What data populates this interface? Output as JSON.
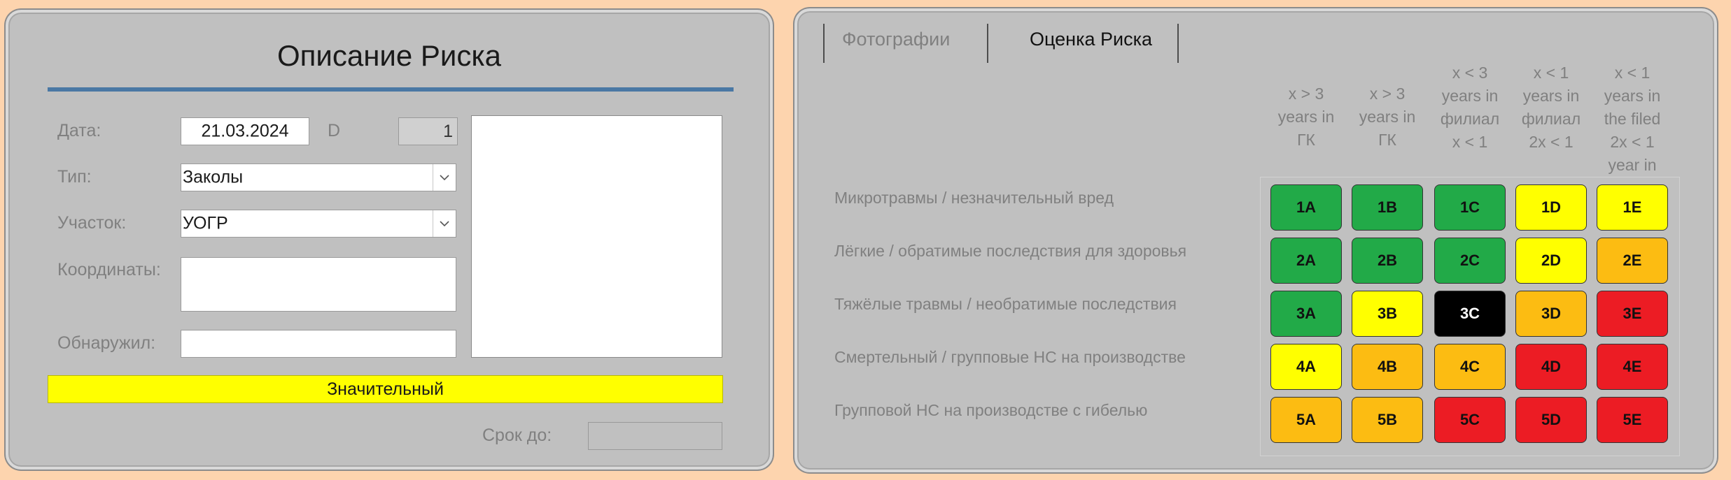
{
  "risk_description": {
    "title": "Описание Риска",
    "date_label": "Дата:",
    "date_value": "21.03.2024",
    "id_label": "D",
    "id_value": "1",
    "type_label": "Тип:",
    "type_value": "Заколы",
    "area_label": "Участок:",
    "area_value": "УОГР",
    "coords_label": "Координаты:",
    "coords_value": "",
    "found_by_label": "Обнаружил:",
    "found_by_value": "",
    "significance": "Значительный",
    "due_label": "Срок до:",
    "due_value": ""
  },
  "tabs": [
    {
      "label": "Фотографии",
      "active": false
    },
    {
      "label": "Оценка Риска",
      "active": true
    }
  ],
  "risk_matrix": {
    "columns": [
      [
        "x > 3",
        "years in",
        "ГК"
      ],
      [
        "x > 3",
        "years in",
        "ГК"
      ],
      [
        "x < 3",
        "years in",
        "филиал",
        "x < 1"
      ],
      [
        "x < 1",
        "years in",
        "филиал",
        "2x < 1"
      ],
      [
        "x < 1",
        "years in",
        "the filed",
        "2x < 1",
        "year in"
      ]
    ],
    "rows": [
      "Микротравмы / незначительный вред",
      "Лёгкие / обратимые последствия для здоровья",
      "Тяжёлые травмы / необратимые последствия",
      "Смертельный / групповые НС на производстве",
      "Групповой НС на производстве с гибелью"
    ],
    "cells": [
      [
        {
          "code": "1A",
          "color": "#22aa48"
        },
        {
          "code": "1B",
          "color": "#22aa48"
        },
        {
          "code": "1C",
          "color": "#22aa48"
        },
        {
          "code": "1D",
          "color": "#ffff00"
        },
        {
          "code": "1E",
          "color": "#ffff00"
        }
      ],
      [
        {
          "code": "2A",
          "color": "#22aa48"
        },
        {
          "code": "2B",
          "color": "#22aa48"
        },
        {
          "code": "2C",
          "color": "#22aa48"
        },
        {
          "code": "2D",
          "color": "#ffff00"
        },
        {
          "code": "2E",
          "color": "#fcbc12"
        }
      ],
      [
        {
          "code": "3A",
          "color": "#22aa48"
        },
        {
          "code": "3B",
          "color": "#ffff00"
        },
        {
          "code": "3C",
          "color": "#000000"
        },
        {
          "code": "3D",
          "color": "#fcbc12"
        },
        {
          "code": "3E",
          "color": "#ec1c24"
        }
      ],
      [
        {
          "code": "4A",
          "color": "#ffff00"
        },
        {
          "code": "4B",
          "color": "#fcbc12"
        },
        {
          "code": "4C",
          "color": "#fcbc12"
        },
        {
          "code": "4D",
          "color": "#ec1c24"
        },
        {
          "code": "4E",
          "color": "#ec1c24"
        }
      ],
      [
        {
          "code": "5A",
          "color": "#fcbc12"
        },
        {
          "code": "5B",
          "color": "#fcbc12"
        },
        {
          "code": "5C",
          "color": "#ec1c24"
        },
        {
          "code": "5D",
          "color": "#ec1c24"
        },
        {
          "code": "5E",
          "color": "#ec1c24"
        }
      ]
    ]
  },
  "colors": {
    "background": "#fdd4ae",
    "panel": "#c0c0c0",
    "title_rule": "#4a78a4",
    "significance_bar": "#ffff00"
  }
}
